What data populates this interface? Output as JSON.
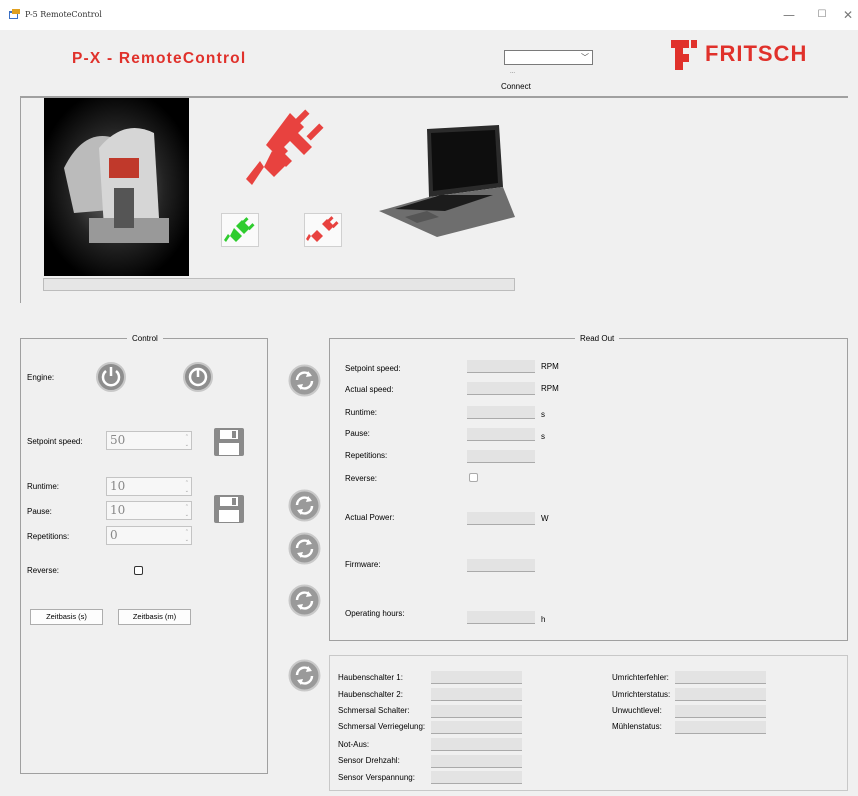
{
  "window": {
    "title": "P-5 RemoteControl",
    "min": "—",
    "max": "☐",
    "close": "✕"
  },
  "header": {
    "app_title": "P-X - RemoteControl",
    "com_dots": "...",
    "connect_label": "Connect",
    "logo_text": "FRITSCH"
  },
  "control": {
    "legend": "Control",
    "engine_label": "Engine:",
    "setpoint_label": "Setpoint speed:",
    "setpoint_value": "50",
    "runtime_label": "Runtime:",
    "runtime_value": "10",
    "pause_label": "Pause:",
    "pause_value": "10",
    "repetitions_label": "Repetitions:",
    "repetitions_value": "0",
    "reverse_label": "Reverse:",
    "zeitbasis_s": "Zeitbasis (s)",
    "zeitbasis_m": "Zeitbasis (m)"
  },
  "readout": {
    "legend": "Read Out",
    "setpoint_label": "Setpoint speed:",
    "setpoint_unit": "RPM",
    "actual_label": "Actual speed:",
    "actual_unit": "RPM",
    "runtime_label": "Runtime:",
    "runtime_unit": "s",
    "pause_label": "Pause:",
    "pause_unit": "s",
    "repetitions_label": "Repetitions:",
    "reverse_label": "Reverse:",
    "power_label": "Actual Power:",
    "power_unit": "W",
    "firmware_label": "Firmware:",
    "hours_label": "Operating hours:",
    "hours_unit": "h"
  },
  "status": {
    "left": [
      "Haubenschalter 1:",
      "Haubenschalter 2:",
      "Schmersal Schalter:",
      "Schmersal Verriegelung:",
      "Not-Aus:",
      "Sensor Drehzahl:",
      "Sensor Verspannung:"
    ],
    "right": [
      "Umrichterfehler:",
      "Umrichterstatus:",
      "Unwuchtlevel:",
      "Mühlenstatus:"
    ]
  },
  "colors": {
    "brand_red": "#e0312b",
    "connected_green": "#22cc22"
  },
  "icons": {
    "plug": "plug-icon",
    "connect": "connect-icon",
    "disconnect": "disconnect-icon",
    "refresh": "refresh-icon",
    "save": "save-icon",
    "power": "power-icon"
  }
}
